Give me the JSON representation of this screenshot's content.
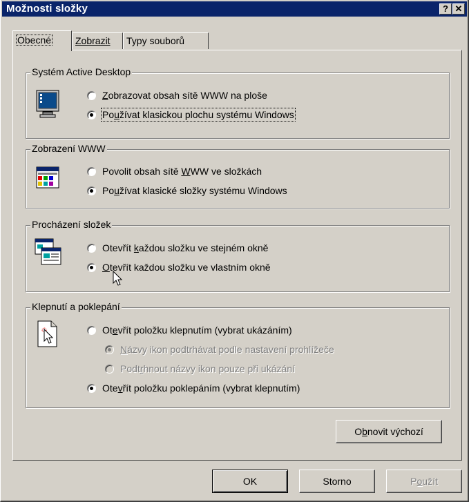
{
  "window": {
    "title": "Možnosti složky",
    "help_button": "?",
    "close_button": "✕"
  },
  "tabs": [
    {
      "label": "Obecné",
      "active": true
    },
    {
      "label": "Zobrazit",
      "active": false
    },
    {
      "label": "Typy souborů",
      "active": false
    }
  ],
  "groups": {
    "active_desktop": {
      "legend": "Systém Active Desktop",
      "icon": "monitor-icon",
      "options": [
        {
          "pre": "",
          "key": "Z",
          "post": "obrazovat obsah sítě WWW na ploše",
          "checked": false
        },
        {
          "pre": "Po",
          "key": "u",
          "post": "žívat klasickou plochu systému Windows",
          "checked": true
        }
      ]
    },
    "web_view": {
      "legend": "Zobrazení WWW",
      "icon": "web-folder-icon",
      "options": [
        {
          "pre": "Povolit obsah sítě ",
          "key": "W",
          "post": "WW ve složkách",
          "checked": false
        },
        {
          "pre": "Po",
          "key": "u",
          "post": "žívat klasické složky systému Windows",
          "checked": true
        }
      ]
    },
    "browse_folders": {
      "legend": "Procházení složek",
      "icon": "windows-cascade-icon",
      "options": [
        {
          "pre": "Otevřít ",
          "key": "k",
          "post": "aždou složku ve stejném okně",
          "checked": false
        },
        {
          "pre": "",
          "key": "O",
          "post": "tevřít každou složku ve vlastním okně",
          "checked": true
        }
      ]
    },
    "click_items": {
      "legend": "Klepnutí a poklepání",
      "icon": "pointer-click-icon",
      "options": [
        {
          "pre": "Ot",
          "key": "e",
          "post": "vřít položku klepnutím (vybrat ukázáním)",
          "checked": false,
          "disabled": false
        },
        {
          "pre": "",
          "key": "N",
          "post": "ázvy ikon podtrhávat podle nastavení prohlížeče",
          "checked": true,
          "disabled": true
        },
        {
          "pre": "Podt",
          "key": "r",
          "post": "hnout názvy ikon pouze při ukázání",
          "checked": false,
          "disabled": true
        },
        {
          "pre": "Ote",
          "key": "v",
          "post": "řít položku poklepáním (vybrat klepnutím)",
          "checked": true,
          "disabled": false
        }
      ]
    }
  },
  "buttons": {
    "restore_defaults": {
      "pre": "O",
      "key": "b",
      "post": "novit výchozí"
    },
    "ok": "OK",
    "cancel": "Storno",
    "apply": {
      "pre": "P",
      "key": "o",
      "post": "užít"
    }
  },
  "colors": {
    "titlebar": "#0a246a",
    "face": "#d4d0c8",
    "desktop_blue": "#0a4a8a"
  }
}
